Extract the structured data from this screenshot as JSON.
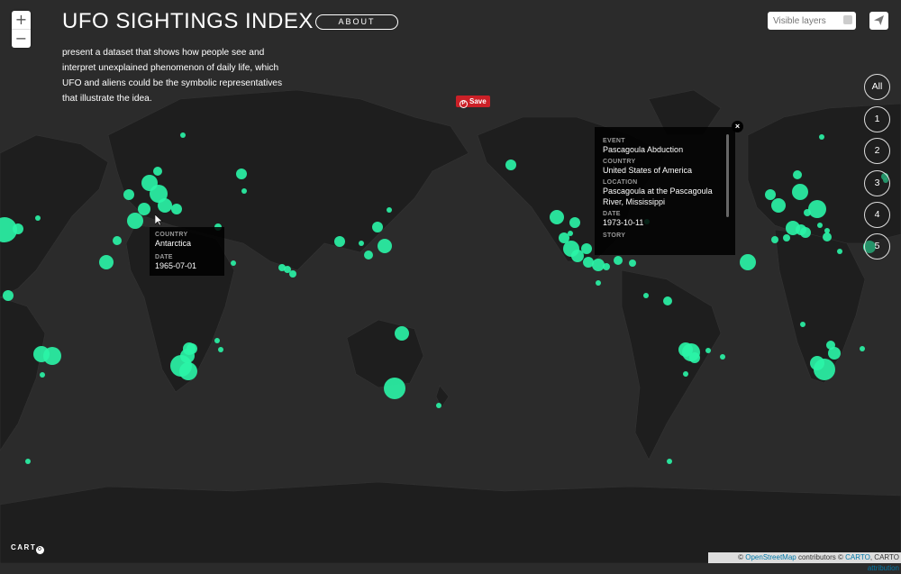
{
  "header": {
    "title": "UFO SIGHTINGS INDEX",
    "about_label": "ABOUT",
    "description": "present a dataset that shows how people see and interpret unexplained phenomenon of daily life, which UFO and aliens could be the symbolic representatives that illustrate the idea."
  },
  "zoom": {
    "in": "+",
    "out": "−"
  },
  "save_button": {
    "label": "Save",
    "icon": "P"
  },
  "layer_search": {
    "placeholder": "Visible layers",
    "value": ""
  },
  "share": {
    "icon": "paper-plane-icon"
  },
  "layer_buttons": [
    "All",
    "1",
    "2",
    "3",
    "4",
    "5"
  ],
  "tooltip_hover": {
    "country_label": "COUNTRY",
    "country": "Antarctica",
    "date_label": "DATE",
    "date": "1965-07-01"
  },
  "popup": {
    "close_label": "×",
    "event_label": "EVENT",
    "event": "Pascagoula Abduction",
    "country_label": "COUNTRY",
    "country": "United States of America",
    "location_label": "LOCATION",
    "location": "Pascagoula at the Pascagoula River, Mississippi",
    "date_label": "DATE",
    "date": "1973-10-11",
    "story_label": "STORY"
  },
  "branding": {
    "logo": "CART",
    "logo_o": "O"
  },
  "attribution": {
    "prefix": "©",
    "osm": "OpenStreetMap",
    "middle": "contributors ©",
    "carto": "CARTO",
    "sep": ", CARTO",
    "attribution_link": "attribution"
  },
  "colors": {
    "marker": "#2af5a7",
    "background": "#2b2b2b",
    "land": "#1f1f1f",
    "save": "#cb2027"
  }
}
